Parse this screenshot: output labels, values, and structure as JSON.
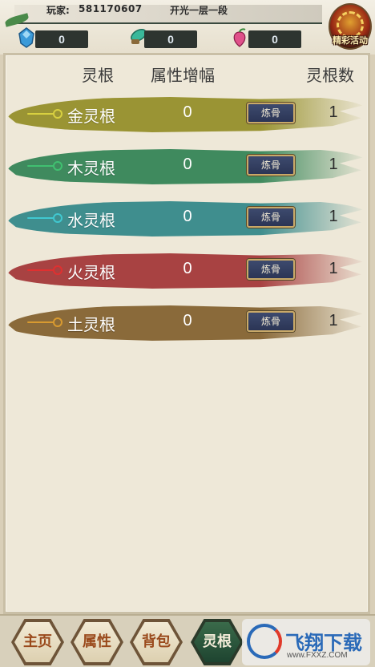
{
  "player": {
    "label": "玩家:",
    "id": "581170607",
    "realm": "开光一层一段"
  },
  "resources": [
    {
      "name": "spirit-stone",
      "value": "0",
      "color": "#3a9ad9"
    },
    {
      "name": "jade-herb",
      "value": "0",
      "color": "#3ab89a"
    },
    {
      "name": "peach",
      "value": "0",
      "color": "#e0508a"
    }
  ],
  "event": {
    "label": "精彩活动"
  },
  "table": {
    "headers": {
      "root": "灵根",
      "bonus": "属性增幅",
      "count": "灵根数"
    },
    "rows": [
      {
        "name": "金灵根",
        "bonus": "0",
        "action": "炼骨",
        "count": "1",
        "color": "#9a9434",
        "gem": "#d8d040"
      },
      {
        "name": "木灵根",
        "bonus": "0",
        "action": "炼骨",
        "count": "1",
        "color": "#3f8a5e",
        "gem": "#40c070"
      },
      {
        "name": "水灵根",
        "bonus": "0",
        "action": "炼骨",
        "count": "1",
        "color": "#3f8e8e",
        "gem": "#40c8d0"
      },
      {
        "name": "火灵根",
        "bonus": "0",
        "action": "炼骨",
        "count": "1",
        "color": "#a84242",
        "gem": "#e03030"
      },
      {
        "name": "土灵根",
        "bonus": "0",
        "action": "炼骨",
        "count": "1",
        "color": "#8a6a3a",
        "gem": "#d89a30"
      }
    ]
  },
  "nav": {
    "items": [
      {
        "label": "主页",
        "active": false
      },
      {
        "label": "属性",
        "active": false
      },
      {
        "label": "背包",
        "active": false
      },
      {
        "label": "灵根",
        "active": true
      }
    ]
  },
  "watermark": {
    "text": "飞翔下载",
    "url": "www.FXXZ.COM"
  }
}
